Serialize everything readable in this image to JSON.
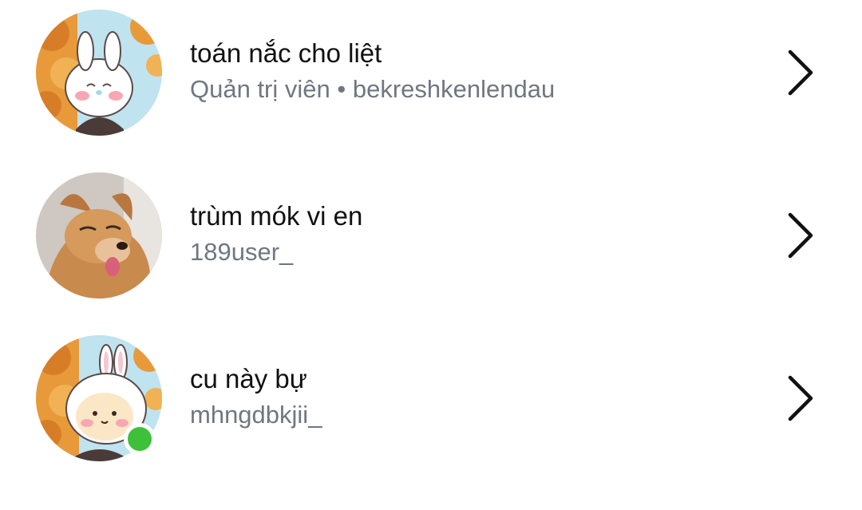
{
  "members": [
    {
      "name": "toán nắc cho liệt",
      "subtitle": "Quản trị viên • bekreshkenlendau",
      "avatar_icon": "bunny-cartoon-avatar",
      "online": false
    },
    {
      "name": "trùm mók vi en",
      "subtitle": "189user_",
      "avatar_icon": "chihuahua-photo-avatar",
      "online": false
    },
    {
      "name": "cu này bự",
      "subtitle": "mhngdbkjii_",
      "avatar_icon": "bunny-hood-cartoon-avatar",
      "online": true
    }
  ],
  "colors": {
    "name_text": "#111111",
    "subtitle_text": "#6f7781",
    "online": "#3ec13a",
    "chevron": "#111111"
  }
}
